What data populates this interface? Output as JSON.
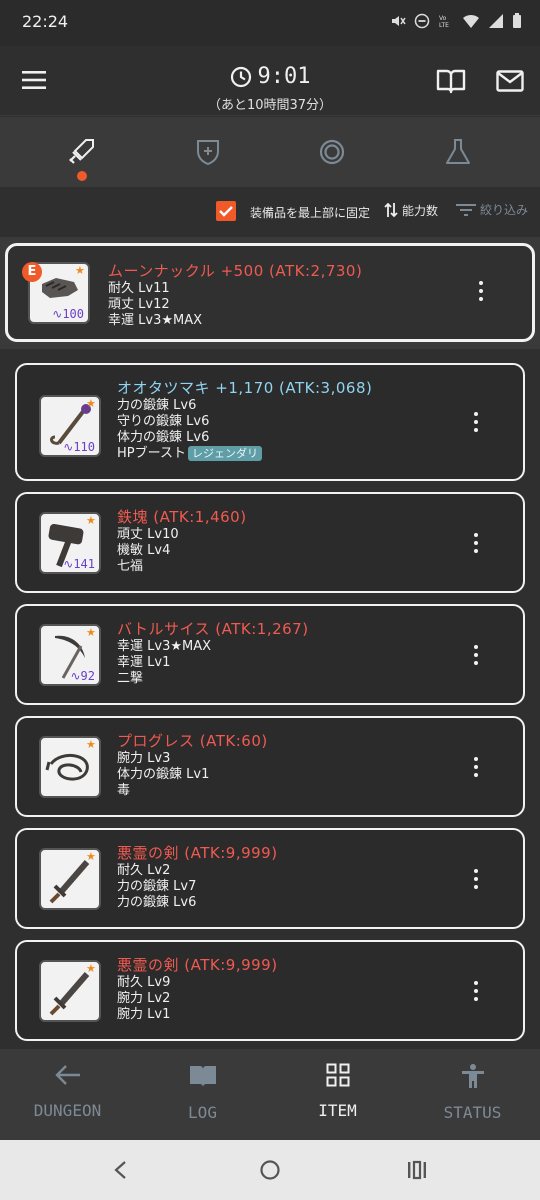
{
  "status_bar": {
    "time": "22:24"
  },
  "header": {
    "timer": "9:01",
    "remaining": "（あと10時間37分）"
  },
  "category_tabs": [
    "weapon-icon",
    "shield-icon",
    "ring-icon",
    "flask-icon"
  ],
  "toolbar": {
    "pin_label": "装備品を最上部に固定",
    "sort_label": "能力数",
    "filter_label": "絞り込み"
  },
  "equipped": {
    "badge": "E",
    "level": "100",
    "name": "ムーンナックル +500 (ATK:2,730)",
    "lines": [
      "耐久 Lv11",
      "頑丈 Lv12",
      "幸運 Lv3★MAX"
    ]
  },
  "items": [
    {
      "level": "110",
      "name": "オオタツマキ +1,170 (ATK:3,068)",
      "rare": true,
      "lines": [
        "力の鍛錬 Lv6",
        "守りの鍛錬 Lv6",
        "体力の鍛錬 Lv6"
      ],
      "extra": "HPブースト",
      "tag": "レジェンダリ"
    },
    {
      "level": "141",
      "name": "鉄塊 (ATK:1,460)",
      "lines": [
        "頑丈 Lv10",
        "機敏 Lv4",
        "七福"
      ]
    },
    {
      "level": "92",
      "name": "バトルサイス (ATK:1,267)",
      "lines": [
        "幸運 Lv3★MAX",
        "幸運 Lv1",
        "二撃"
      ]
    },
    {
      "level": "",
      "name": "プログレス (ATK:60)",
      "lines": [
        "腕力 Lv3",
        "体力の鍛錬 Lv1",
        "毒"
      ]
    },
    {
      "level": "",
      "name": "悪霊の剣 (ATK:9,999)",
      "lines": [
        "耐久 Lv2",
        "力の鍛錬 Lv7",
        "力の鍛錬 Lv6"
      ]
    },
    {
      "level": "",
      "name": "悪霊の剣 (ATK:9,999)",
      "lines": [
        "耐久 Lv9",
        "腕力 Lv2",
        "腕力 Lv1"
      ]
    }
  ],
  "nav": [
    {
      "label": "DUNGEON",
      "icon": "arrow-left-icon"
    },
    {
      "label": "LOG",
      "icon": "book-icon"
    },
    {
      "label": "ITEM",
      "icon": "grid-icon",
      "active": true
    },
    {
      "label": "STATUS",
      "icon": "person-icon"
    }
  ],
  "colors": {
    "accent": "#f05a28",
    "rare_name": "#8fd4f0",
    "normal_name": "#f05a50",
    "level": "#6b3fc8"
  }
}
